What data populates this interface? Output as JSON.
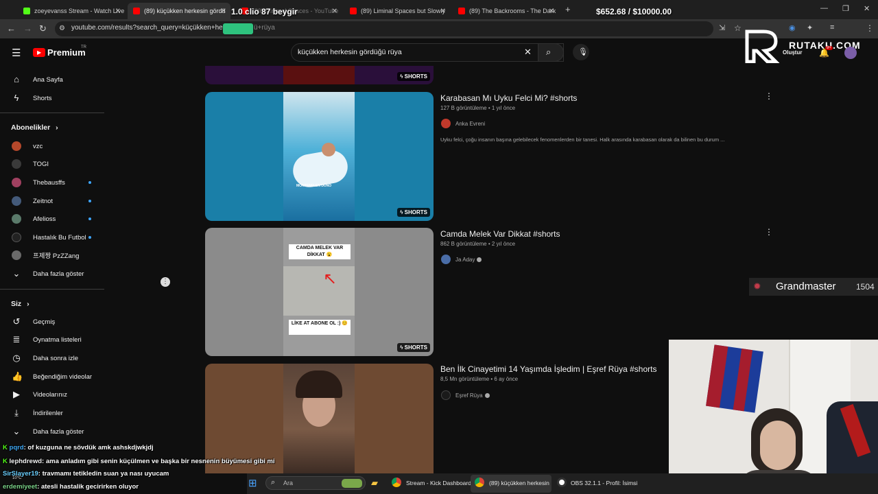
{
  "browser": {
    "tabs": [
      {
        "label": "zoeyevanss Stream - Watch Live",
        "color": "#53fc18"
      },
      {
        "label": "(89) küçükken herkesin gördü",
        "color": "#ff0000"
      },
      {
        "label": "(89) Minimal Spaces - YouTube",
        "color": "#ff0000"
      },
      {
        "label": "(89) Liminal Spaces but Slowly",
        "color": "#ff0000"
      },
      {
        "label": "(89) The Backrooms - The Dark",
        "color": "#ff0000"
      }
    ],
    "url": "youtube.com/results?search_query=küçükken+herkes",
    "url_tail": "ü+rüya",
    "new_tab": "+"
  },
  "overlay": {
    "car_text": "1.0 clio 87 beygir",
    "money": "$652.68 / $10000.00",
    "brand": "RUTAKU.COM",
    "rank_label": "Grandmaster",
    "rank_value": "1504"
  },
  "yt": {
    "logo": "Premium",
    "logo_region": "TR",
    "search_value": "küçükken herkesin gördüğü rüya",
    "create_label": "Oluştur",
    "notif_count": "9+"
  },
  "sidebar": {
    "main": [
      {
        "label": "Ana Sayfa",
        "icon": "home-icon"
      },
      {
        "label": "Shorts",
        "icon": "shorts-icon"
      }
    ],
    "subs_title": "Abonelikler",
    "subs": [
      {
        "label": "vzc",
        "color": "#b5482b",
        "dot": false
      },
      {
        "label": "TOGI",
        "color": "#3a3a3a",
        "dot": false
      },
      {
        "label": "Thebausffs",
        "color": "#a04060",
        "dot": true
      },
      {
        "label": "Zeitnot",
        "color": "#445a7a",
        "dot": true
      },
      {
        "label": "Afelioss",
        "color": "#5a7a6a",
        "dot": true
      },
      {
        "label": "Hastalık Bu Futbol",
        "color": "#222222",
        "dot": true
      },
      {
        "label": "프제짱 PzZZang",
        "color": "#6a6a6a",
        "dot": false
      }
    ],
    "subs_more": "Daha fazla göster",
    "you_title": "Siz",
    "you": [
      {
        "label": "Geçmiş",
        "icon": "history-icon"
      },
      {
        "label": "Oynatma listeleri",
        "icon": "playlist-icon"
      },
      {
        "label": "Daha sonra izle",
        "icon": "watch-later-icon"
      },
      {
        "label": "Beğendiğim videolar",
        "icon": "like-icon"
      },
      {
        "label": "Videolarınız",
        "icon": "video-icon"
      },
      {
        "label": "İndirilenler",
        "icon": "download-icon"
      }
    ],
    "you_more": "Daha fazla göster"
  },
  "results": [
    {
      "title": "",
      "views": "",
      "age": "",
      "channel": "",
      "desc": "",
      "badge": "SHORTS",
      "thumb_bg": "#2a0f3a",
      "thumb_inner": "#5a1010"
    },
    {
      "title": "Karabasan Mı Uyku Felci Mi? #shorts",
      "views": "127 B görüntüleme",
      "age": "1 yıl önce",
      "channel": "Anka Evreni",
      "desc": "Uyku felci, çoğu insanın başına gelebilecek fenomenlerden bir tanesi. Halk arasında karabasan olarak da bilinen bu durum ...",
      "badge": "SHORTS",
      "thumb_bg": "#1a7fa8",
      "thumb_inner": "#2f9bc8",
      "thumb_caption": "MONTENELEN DÜNO"
    },
    {
      "title": "Camda Melek Var Dikkat #shorts",
      "views": "862 B görüntüleme",
      "age": "2 yıl önce",
      "channel": "Ja Aday",
      "desc": "",
      "badge": "SHORTS",
      "thumb_bg": "#8b8b8b",
      "thumb_inner": "#a9a9a9",
      "thumb_caption_top": "CAMDA MELEK VAR DİKKAT 😮",
      "thumb_caption_bottom": "LİKE AT ABONE OL :) 😊"
    },
    {
      "title": "Ben İlk Cinayetimi 14 Yaşımda İşledim | Eşref Rüya #shorts",
      "views": "8,5 Mn görüntüleme",
      "age": "6 ay önce",
      "channel": "Eşref Rüya",
      "desc": "",
      "badge": "",
      "thumb_bg": "#6e4a32",
      "thumb_inner": "#4a3a30"
    }
  ],
  "chat": [
    {
      "user": "pqrd",
      "msg": ": of kuzguna ne sövdük amk ashskdjwkjdj"
    },
    {
      "user": "lephdrewd",
      "msg": ": ama anladım gibi senin küçülmen ve başka bir nesnenin büyümesi gibi mi"
    },
    {
      "user": "SirSlayer19",
      "msg": ": travmamı tetikledin suan ya nası uyucam"
    },
    {
      "user": "erdemiyeet",
      "msg": ": atesli hastalik gecirirken oluyor"
    }
  ],
  "taskbar": {
    "search_placeholder": "Ara",
    "weather": "10°C",
    "items": [
      "Stream - Kick Dashboard",
      "(89) küçükken herkesin",
      "OBS 32.1.1 - Profil: İsimsi"
    ]
  }
}
